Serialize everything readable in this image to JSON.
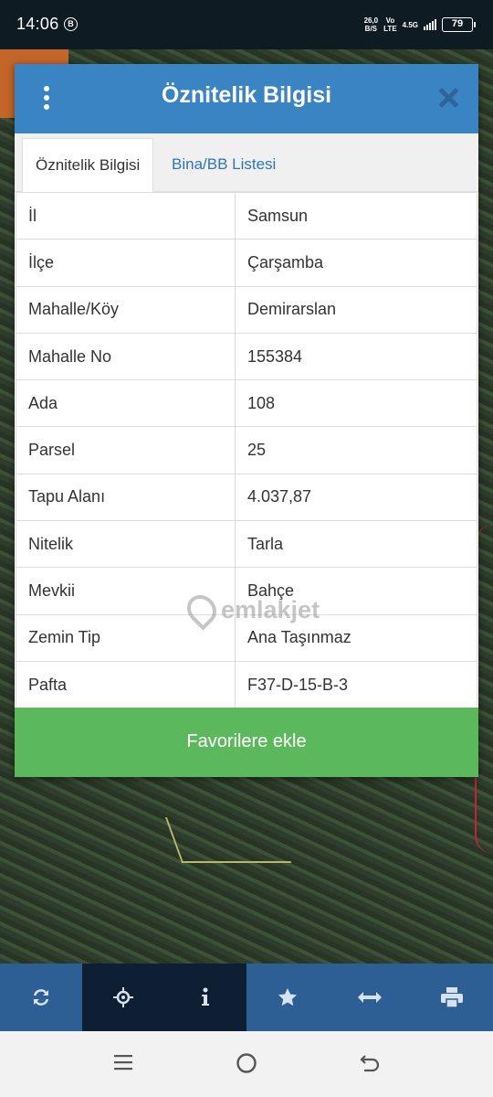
{
  "status_bar": {
    "time": "14:06",
    "b_badge": "B",
    "speed_value": "26,0",
    "speed_unit": "B/S",
    "volte_top": "Vo",
    "volte_bottom": "LTE",
    "network": "4.5G",
    "battery": "79"
  },
  "dialog": {
    "title": "Öznitelik Bilgisi",
    "tabs": [
      {
        "label": "Öznitelik Bilgisi",
        "active": true
      },
      {
        "label": "Bina/BB Listesi",
        "active": false
      }
    ],
    "rows": [
      {
        "key": "İl",
        "value": "Samsun"
      },
      {
        "key": "İlçe",
        "value": "Çarşamba"
      },
      {
        "key": "Mahalle/Köy",
        "value": "Demirarslan"
      },
      {
        "key": "Mahalle No",
        "value": "155384"
      },
      {
        "key": "Ada",
        "value": "108"
      },
      {
        "key": "Parsel",
        "value": "25"
      },
      {
        "key": "Tapu Alanı",
        "value": "4.037,87"
      },
      {
        "key": "Nitelik",
        "value": "Tarla"
      },
      {
        "key": "Mevkii",
        "value": "Bahçe"
      },
      {
        "key": "Zemin Tip",
        "value": "Ana Taşınmaz"
      },
      {
        "key": "Pafta",
        "value": "F37-D-15-B-3"
      }
    ],
    "favorite_button": "Favorilere ekle"
  },
  "watermark": "emlakjet",
  "toolbar": {
    "items": [
      {
        "icon": "refresh-icon",
        "active": false
      },
      {
        "icon": "locate-icon",
        "active": true
      },
      {
        "icon": "info-icon",
        "active": true
      },
      {
        "icon": "star-icon",
        "active": false
      },
      {
        "icon": "measure-icon",
        "active": false
      },
      {
        "icon": "print-icon",
        "active": false
      }
    ]
  },
  "colors": {
    "header": "#3a84c4",
    "tab_link": "#2f75b8",
    "button": "#5cb85c",
    "toolbar": "#2d5f94"
  }
}
